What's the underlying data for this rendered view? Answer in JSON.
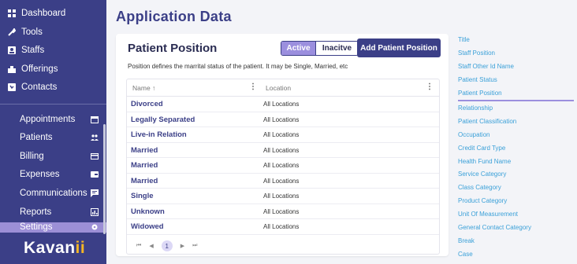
{
  "sidebar": {
    "top_items": [
      {
        "label": "Dashboard",
        "icon": "dashboard-icon"
      },
      {
        "label": "Tools",
        "icon": "wrench-icon"
      },
      {
        "label": "Staffs",
        "icon": "staff-icon"
      },
      {
        "label": "Offerings",
        "icon": "offerings-icon"
      },
      {
        "label": "Contacts",
        "icon": "contacts-icon"
      }
    ],
    "sub_items": [
      {
        "label": "Appointments",
        "icon": "calendar-icon"
      },
      {
        "label": "Patients",
        "icon": "people-icon"
      },
      {
        "label": "Billing",
        "icon": "card-icon"
      },
      {
        "label": "Expenses",
        "icon": "wallet-icon"
      },
      {
        "label": "Communications",
        "icon": "chat-icon"
      },
      {
        "label": "Reports",
        "icon": "chart-icon"
      },
      {
        "label": "Settings",
        "icon": "gear-icon"
      }
    ],
    "logo": {
      "main": "Kavan",
      "accent": "ii"
    }
  },
  "page": {
    "title": "Application Data"
  },
  "card": {
    "title": "Patient Position",
    "toggle": {
      "active": "Active",
      "inactive": "Inacitve"
    },
    "add_button": "Add Patient Position",
    "description": "Position defines the marrital status of the patient. It may be Single, Married, etc",
    "table": {
      "columns": [
        {
          "label": "Name ↑"
        },
        {
          "label": "Location"
        }
      ],
      "rows": [
        {
          "name": "Divorced",
          "location": "All Locations"
        },
        {
          "name": "Legally Separated",
          "location": "All Locations"
        },
        {
          "name": "Live-in Relation",
          "location": "All Locations"
        },
        {
          "name": "Married",
          "location": "All Locations"
        },
        {
          "name": "Married",
          "location": "All Locations"
        },
        {
          "name": "Married",
          "location": "All Locations"
        },
        {
          "name": "Single",
          "location": "All Locations"
        },
        {
          "name": "Unknown",
          "location": "All Locations"
        },
        {
          "name": "Widowed",
          "location": "All Locations"
        }
      ]
    },
    "pagination": {
      "first": "⏮",
      "prev": "◀",
      "current": "1",
      "next": "▶",
      "last": "⏭"
    }
  },
  "right_menu": [
    "Title",
    "Staff Position",
    "Staff Other Id Name",
    "Patient Status",
    "Patient Position",
    "Relationship",
    "Patient Classification",
    "Occupation",
    "Credit Card Type",
    "Health Fund Name",
    "Service Category",
    "Class Category",
    "Product Category",
    "Unit Of Measurement",
    "General Contact Category",
    "Break",
    "Case"
  ],
  "colors": {
    "brand": "#3b3f87",
    "accent": "#9b8fde",
    "link": "#3aa0d8",
    "logo_accent": "#f5b624"
  }
}
